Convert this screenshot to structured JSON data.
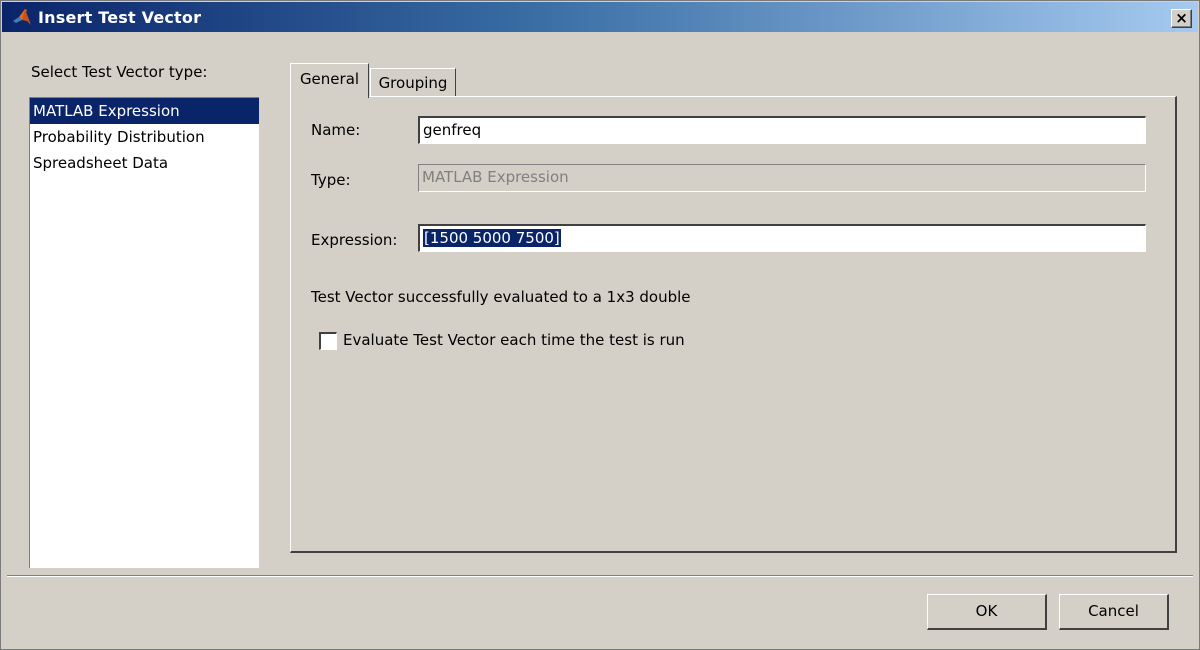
{
  "window": {
    "title": "Insert Test Vector",
    "close_glyph": "×",
    "icon": "matlab-logo-icon"
  },
  "left_panel": {
    "label": "Select Test Vector type:",
    "items": [
      {
        "label": "MATLAB Expression",
        "selected": true
      },
      {
        "label": "Probability Distribution",
        "selected": false
      },
      {
        "label": "Spreadsheet Data",
        "selected": false
      }
    ]
  },
  "tabs": [
    {
      "label": "General",
      "active": true
    },
    {
      "label": "Grouping",
      "active": false
    }
  ],
  "form": {
    "name_label": "Name:",
    "name_value": "genfreq",
    "type_label": "Type:",
    "type_value": "MATLAB Expression",
    "expression_label": "Expression:",
    "expression_value": "[1500 5000 7500]",
    "status": "Test Vector successfully evaluated to a 1x3 double",
    "checkbox_label": "Evaluate Test Vector each time the test is run",
    "checkbox_checked": false
  },
  "buttons": {
    "ok": "OK",
    "cancel": "Cancel"
  },
  "colors": {
    "selection": "#0a246a",
    "dialog_bg": "#d4d0c8"
  }
}
